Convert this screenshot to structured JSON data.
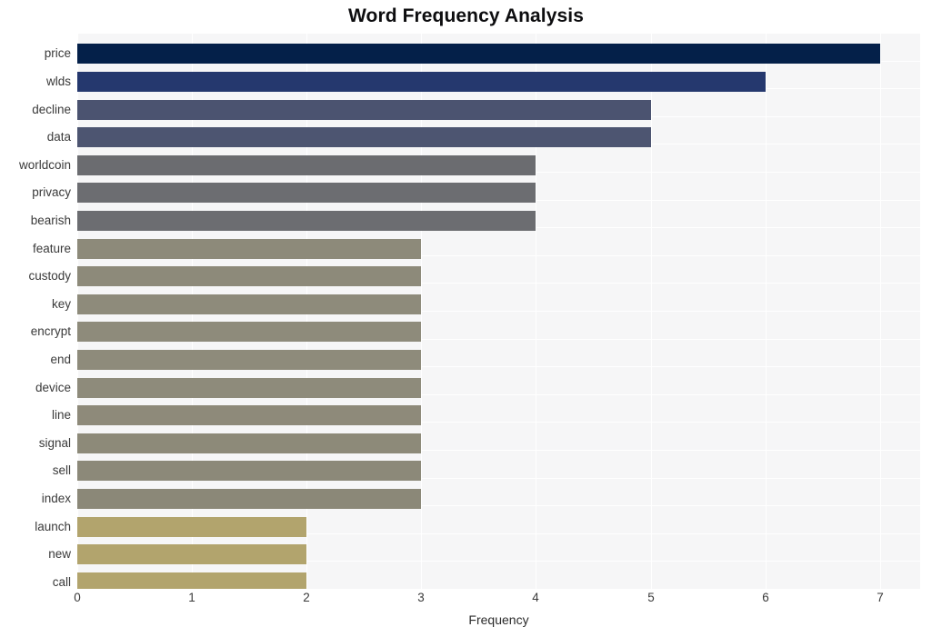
{
  "chart_data": {
    "type": "bar",
    "orientation": "horizontal",
    "title": "Word Frequency Analysis",
    "xlabel": "Frequency",
    "ylabel": "",
    "xlim": [
      0,
      7.35
    ],
    "xticks": [
      0,
      1,
      2,
      3,
      4,
      5,
      6,
      7
    ],
    "xtick_labels": [
      "0",
      "1",
      "2",
      "3",
      "4",
      "5",
      "6",
      "7"
    ],
    "grid": true,
    "grid_color": "#ffffff",
    "plot_background": "#f6f6f7",
    "figure_background": "#ffffff",
    "legend": null,
    "categories": [
      "price",
      "wlds",
      "decline",
      "data",
      "worldcoin",
      "privacy",
      "bearish",
      "feature",
      "custody",
      "key",
      "encrypt",
      "end",
      "device",
      "line",
      "signal",
      "sell",
      "index",
      "launch",
      "new",
      "call"
    ],
    "values": [
      7,
      6,
      5,
      5,
      4,
      4,
      4,
      3,
      3,
      3,
      3,
      3,
      3,
      3,
      3,
      3,
      3,
      2,
      2,
      2
    ],
    "bar_colors": [
      "#042049",
      "#25386e",
      "#4b5370",
      "#4d5571",
      "#6b6c70",
      "#6c6d71",
      "#6c6d71",
      "#8d8a7a",
      "#8d8a7a",
      "#8e8b7b",
      "#8e8b7b",
      "#8e8b7b",
      "#8e8b7b",
      "#8e8a7a",
      "#8d8a79",
      "#8c8979",
      "#8b8878",
      "#b2a46d",
      "#b2a46d",
      "#b2a46d"
    ]
  }
}
